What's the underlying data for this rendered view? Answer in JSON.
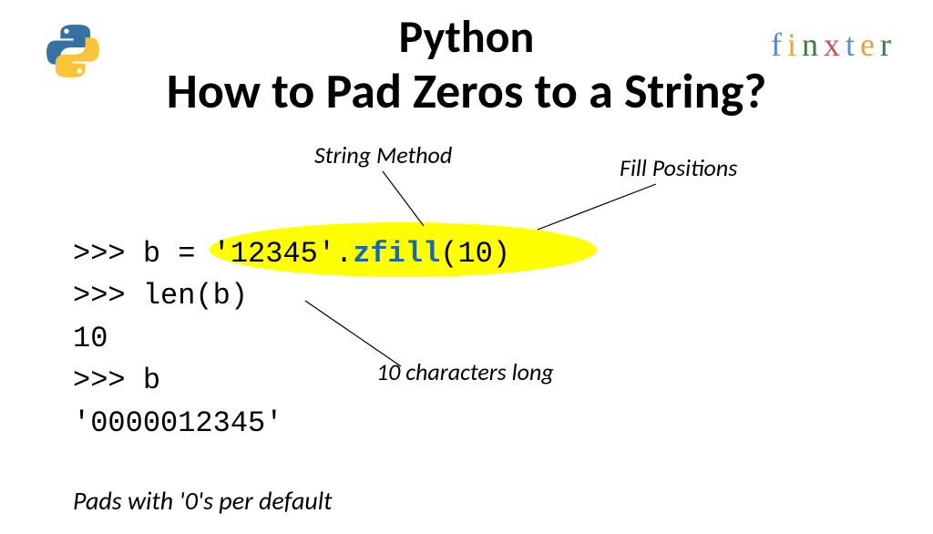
{
  "title": {
    "line1": "Python",
    "line2": "How to Pad Zeros to a String?"
  },
  "brand": {
    "letters": [
      "f",
      "i",
      "n",
      "x",
      "t",
      "e",
      "r"
    ]
  },
  "annotations": {
    "string_method": "String Method",
    "fill_positions": "Fill Positions",
    "ten_chars": "10 characters long",
    "pads_default": "Pads with '0's per default"
  },
  "code": {
    "line1_pre": ">>> b = '12345'.",
    "line1_method": "zfill",
    "line1_post": "(10)",
    "line2": ">>> len(b)",
    "line3": "10",
    "line4": ">>> b",
    "line5": "'0000012345'"
  }
}
